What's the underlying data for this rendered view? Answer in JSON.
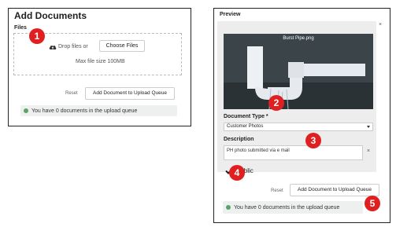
{
  "left": {
    "title": "Add Documents",
    "files_label": "Files",
    "drop_text": "Drop files or",
    "choose_files_label": "Choose Files",
    "max_size": "Max file size 100MB",
    "reset_label": "Reset",
    "add_button_label": "Add Document to Upload Queue",
    "queue_notice": "You have 0 documents in the upload queue"
  },
  "right": {
    "title": "Preview",
    "close_glyph": "×",
    "image_filename": "Burst Pipe.png",
    "document_type_label": "Document Type *",
    "document_type_value": "Customer Photos",
    "description_label": "Description",
    "description_value": "PH photo submitted via e mail",
    "description_clear_glyph": "×",
    "public_label": "Public",
    "reset_label": "Reset",
    "add_button_label": "Add Document to Upload Queue",
    "queue_notice": "You have 0 documents in the upload queue"
  },
  "badges": [
    "1",
    "2",
    "3",
    "4",
    "5"
  ],
  "colors": {
    "badge": "#e02020",
    "info": "#5aa36a",
    "notice_bg": "#eef0ef",
    "preview_bg": "#ededed",
    "image_bg": "#353f44"
  }
}
